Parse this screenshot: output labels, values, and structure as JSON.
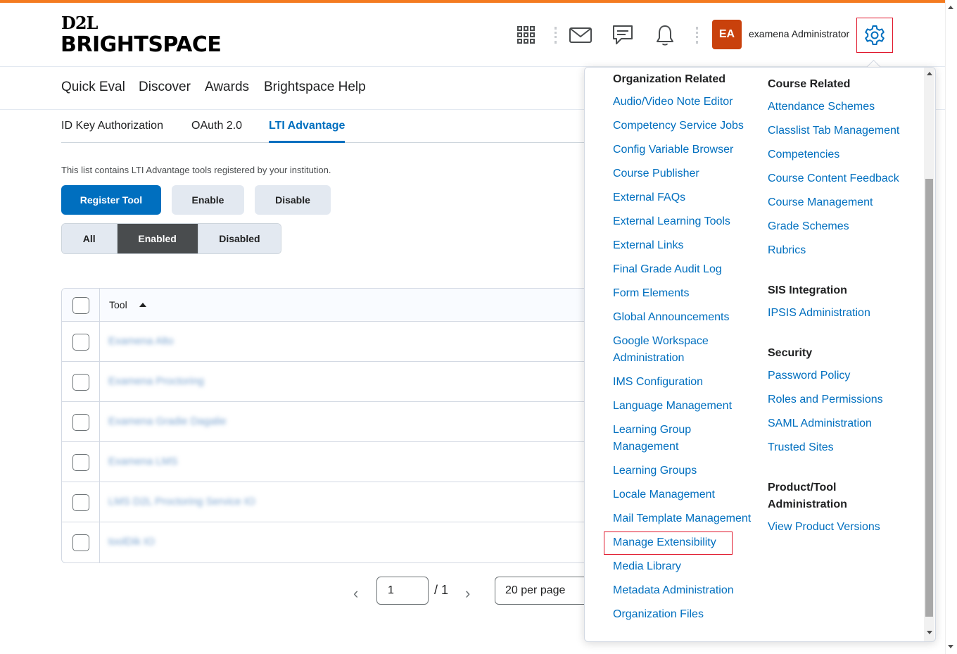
{
  "brand": {
    "logo_top": "D2L",
    "logo_bottom": "BRIGHTSPACE"
  },
  "header": {
    "avatar_initials": "EA",
    "username": "examena Administrator",
    "icons": [
      "apps-grid-icon",
      "mail-icon",
      "chat-icon",
      "bell-icon",
      "gear-icon"
    ]
  },
  "navbar": {
    "items": [
      "Quick Eval",
      "Discover",
      "Awards",
      "Brightspace Help"
    ]
  },
  "tabs": {
    "items": [
      "ID Key Authorization",
      "OAuth 2.0",
      "LTI Advantage"
    ],
    "active": "LTI Advantage"
  },
  "main": {
    "description": "This list contains LTI Advantage tools registered by your institution.",
    "register_label": "Register Tool",
    "enable_label": "Enable",
    "disable_label": "Disable",
    "filters": [
      "All",
      "Enabled",
      "Disabled"
    ],
    "active_filter": "Enabled"
  },
  "table": {
    "header_tool": "Tool",
    "rows": [
      "Examena Alto",
      "Examena Proctoring",
      "Examena Gradie Dagalie",
      "Examena LMS",
      "LMS D2L Proctoring Service IO",
      "toolDik IO"
    ]
  },
  "pager": {
    "current_page": "1",
    "total": "/ 1",
    "per_page": "20 per page"
  },
  "admin_menu": {
    "col1": {
      "heading": "Organization Related",
      "links": [
        "Audio/Video Note Editor",
        "Competency Service Jobs",
        "Config Variable Browser",
        "Course Publisher",
        "External FAQs",
        "External Learning Tools",
        "External Links",
        "Final Grade Audit Log",
        "Form Elements",
        "Global Announcements",
        "Google Workspace Administration",
        "IMS Configuration",
        "Language Management",
        "Learning Group Management",
        "Learning Groups",
        "Locale Management",
        "Mail Template Management",
        "Manage Extensibility",
        "Media Library",
        "Metadata Administration",
        "Organization Files"
      ]
    },
    "col2": {
      "course_heading": "Course Related",
      "course_links": [
        "Attendance Schemes",
        "Classlist Tab Management",
        "Competencies",
        "Course Content Feedback",
        "Course Management",
        "Grade Schemes",
        "Rubrics"
      ],
      "sis_heading": "SIS Integration",
      "sis_links": [
        "IPSIS Administration"
      ],
      "security_heading": "Security",
      "security_links": [
        "Password Policy",
        "Roles and Permissions",
        "SAML Administration",
        "Trusted Sites"
      ],
      "product_heading": "Product/Tool Administration",
      "product_links": [
        "View Product Versions"
      ]
    }
  },
  "colors": {
    "accent": "#f47b20",
    "link": "#006fbf",
    "avatar": "#c9410c",
    "highlight": "#e0162b"
  }
}
